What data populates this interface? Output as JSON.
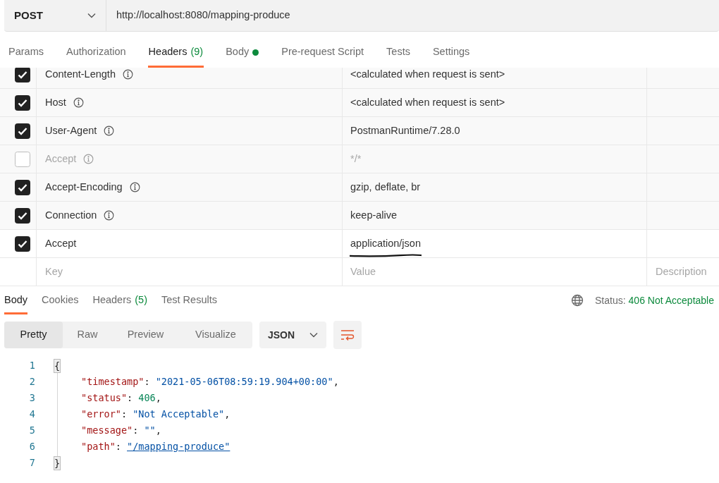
{
  "request": {
    "method": "POST",
    "url": "http://localhost:8080/mapping-produce"
  },
  "request_tabs": [
    {
      "label": "Params",
      "selected": false
    },
    {
      "label": "Authorization",
      "selected": false
    },
    {
      "label": "Headers",
      "count": "(9)",
      "selected": true
    },
    {
      "label": "Body",
      "dot": true,
      "selected": false
    },
    {
      "label": "Pre-request Script",
      "selected": false
    },
    {
      "label": "Tests",
      "selected": false
    },
    {
      "label": "Settings",
      "selected": false
    }
  ],
  "headers": [
    {
      "checked": true,
      "key": "Content-Length",
      "info": true,
      "value": "<calculated when request is sent>"
    },
    {
      "checked": true,
      "key": "Host",
      "info": true,
      "value": "<calculated when request is sent>"
    },
    {
      "checked": true,
      "key": "User-Agent",
      "info": true,
      "value": "PostmanRuntime/7.28.0"
    },
    {
      "checked": false,
      "key": "Accept",
      "info": true,
      "value": "*/*"
    },
    {
      "checked": true,
      "key": "Accept-Encoding",
      "info": true,
      "value": "gzip, deflate, br"
    },
    {
      "checked": true,
      "key": "Connection",
      "info": true,
      "value": "keep-alive"
    },
    {
      "checked": true,
      "key": "Accept",
      "info": false,
      "value": "application/json",
      "underlined": true
    }
  ],
  "new_header": {
    "key_placeholder": "Key",
    "value_placeholder": "Value",
    "description_placeholder": "Description"
  },
  "response_tabs": [
    {
      "label": "Body",
      "selected": true
    },
    {
      "label": "Cookies",
      "selected": false
    },
    {
      "label": "Headers",
      "count": "(5)",
      "selected": false
    },
    {
      "label": "Test Results",
      "selected": false
    }
  ],
  "status": {
    "label": "Status:",
    "value": "406 Not Acceptable"
  },
  "view_modes": [
    {
      "label": "Pretty",
      "selected": true
    },
    {
      "label": "Raw",
      "selected": false
    },
    {
      "label": "Preview",
      "selected": false
    },
    {
      "label": "Visualize",
      "selected": false
    }
  ],
  "format": "JSON",
  "code_lines": [
    {
      "number": "1",
      "tokens": [
        {
          "kind": "brace",
          "text": "{"
        }
      ]
    },
    {
      "number": "2",
      "tokens": [
        {
          "kind": "key",
          "text": "\"timestamp\""
        },
        {
          "kind": "punct",
          "text": ": "
        },
        {
          "kind": "string",
          "text": "\"2021-05-06T08:59:19.904+00:00\""
        },
        {
          "kind": "punct",
          "text": ","
        }
      ]
    },
    {
      "number": "3",
      "tokens": [
        {
          "kind": "key",
          "text": "\"status\""
        },
        {
          "kind": "punct",
          "text": ": "
        },
        {
          "kind": "number",
          "text": "406"
        },
        {
          "kind": "punct",
          "text": ","
        }
      ]
    },
    {
      "number": "4",
      "tokens": [
        {
          "kind": "key",
          "text": "\"error\""
        },
        {
          "kind": "punct",
          "text": ": "
        },
        {
          "kind": "string",
          "text": "\"Not Acceptable\""
        },
        {
          "kind": "punct",
          "text": ","
        }
      ]
    },
    {
      "number": "5",
      "tokens": [
        {
          "kind": "key",
          "text": "\"message\""
        },
        {
          "kind": "punct",
          "text": ": "
        },
        {
          "kind": "string",
          "text": "\"\""
        },
        {
          "kind": "punct",
          "text": ","
        }
      ]
    },
    {
      "number": "6",
      "tokens": [
        {
          "kind": "key",
          "text": "\"path\""
        },
        {
          "kind": "punct",
          "text": ": "
        },
        {
          "kind": "link",
          "text": "\"/mapping-produce\""
        }
      ]
    },
    {
      "number": "7",
      "tokens": [
        {
          "kind": "brace",
          "text": "}"
        }
      ]
    }
  ]
}
